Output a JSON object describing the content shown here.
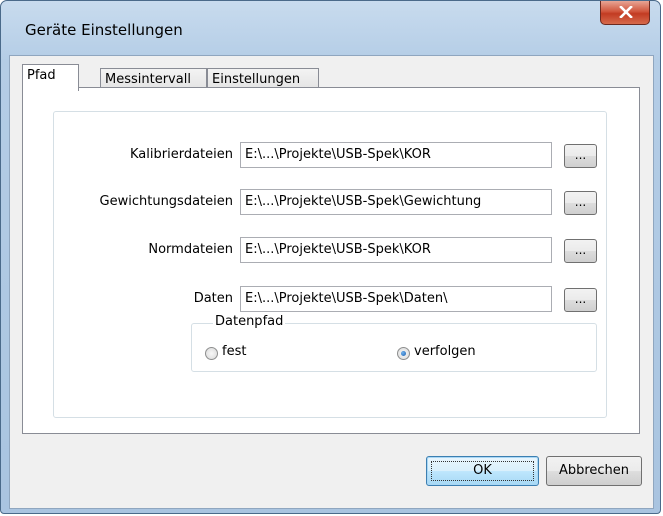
{
  "window": {
    "title": "Geräte Einstellungen"
  },
  "tabs": [
    {
      "label": "Pfad",
      "active": true
    },
    {
      "label": "Messintervall",
      "active": false
    },
    {
      "label": "Einstellungen",
      "active": false
    }
  ],
  "paths": [
    {
      "label": "Kalibrierdateien",
      "value": "E:\\...\\Projekte\\USB-Spek\\KOR",
      "browse_label": "..."
    },
    {
      "label": "Gewichtungsdateien",
      "value": "E:\\...\\Projekte\\USB-Spek\\Gewichtung",
      "browse_label": "..."
    },
    {
      "label": "Normdateien",
      "value": "E:\\...\\Projekte\\USB-Spek\\KOR",
      "browse_label": "..."
    },
    {
      "label": "Daten",
      "value": "E:\\...\\Projekte\\USB-Spek\\Daten\\",
      "browse_label": "..."
    }
  ],
  "datenpfad": {
    "legend": "Datenpfad",
    "options": [
      {
        "label": "fest",
        "checked": false
      },
      {
        "label": "verfolgen",
        "checked": true
      }
    ]
  },
  "buttons": {
    "ok": "OK",
    "cancel": "Abbrechen"
  },
  "icons": {
    "close": "close-icon"
  },
  "colors": {
    "close_button": "#c23b22",
    "title_bar": "#b4cde6"
  }
}
